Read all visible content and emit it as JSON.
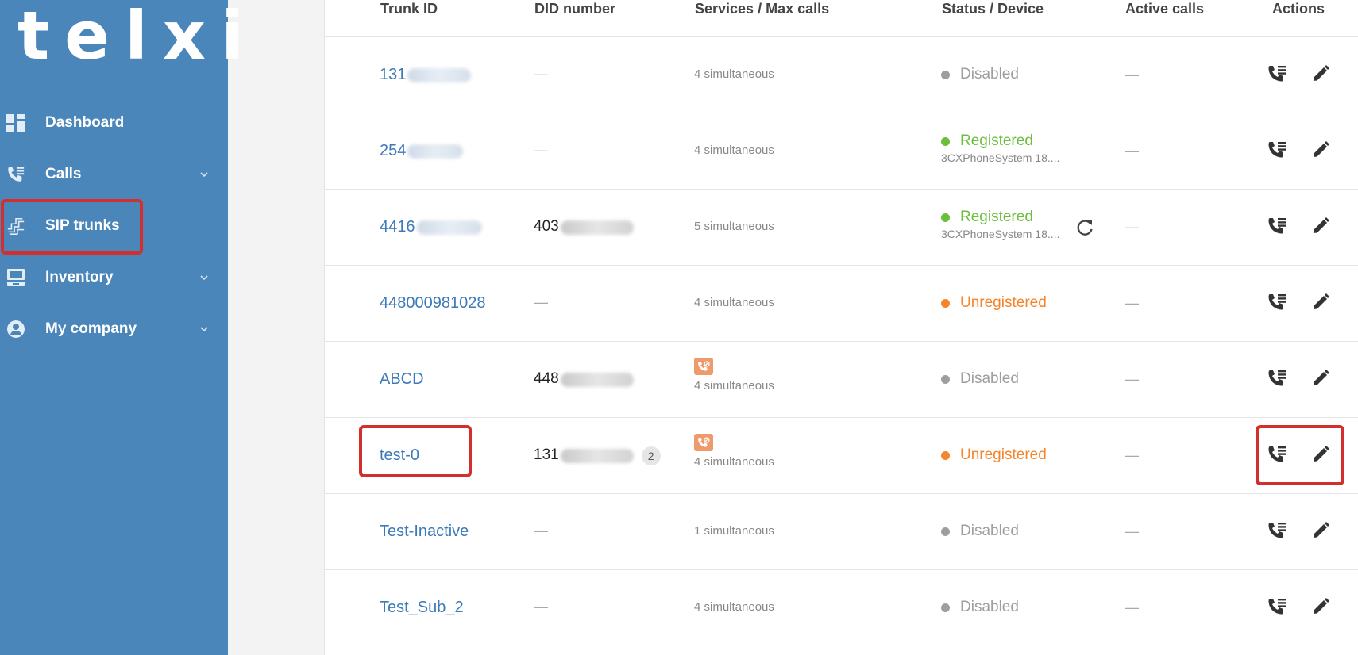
{
  "brand": {
    "logo_text": "telxi"
  },
  "sidebar": {
    "items": [
      {
        "label": "Dashboard",
        "icon": "dashboard-icon",
        "has_chevron": false
      },
      {
        "label": "Calls",
        "icon": "calls-icon",
        "has_chevron": true
      },
      {
        "label": "SIP trunks",
        "icon": "sip-trunks-icon",
        "has_chevron": false,
        "active": true
      },
      {
        "label": "Inventory",
        "icon": "inventory-icon",
        "has_chevron": true
      },
      {
        "label": "My company",
        "icon": "company-icon",
        "has_chevron": true
      }
    ]
  },
  "table": {
    "headers": {
      "trunk_id": "Trunk ID",
      "did_number": "DID number",
      "services": "Services / Max calls",
      "status": "Status / Device",
      "active_calls": "Active calls",
      "actions": "Actions"
    },
    "rows": [
      {
        "trunk_id": "131",
        "trunk_blurred": true,
        "did": "—",
        "did_blurred": false,
        "service_icon": false,
        "services": "4 simultaneous",
        "status": "Disabled",
        "status_color": "#9e9e9e",
        "device": "",
        "refresh": false,
        "active_calls": "—"
      },
      {
        "trunk_id": "254",
        "trunk_blurred": true,
        "did": "—",
        "did_blurred": false,
        "service_icon": false,
        "services": "4 simultaneous",
        "status": "Registered",
        "status_color": "#6cbf3c",
        "device": "3CXPhoneSystem 18....",
        "refresh": false,
        "active_calls": "—"
      },
      {
        "trunk_id": "4416",
        "trunk_blurred": true,
        "did": "403",
        "did_blurred": true,
        "service_icon": false,
        "services": "5 simultaneous",
        "status": "Registered",
        "status_color": "#6cbf3c",
        "device": "3CXPhoneSystem 18....",
        "refresh": true,
        "active_calls": "—"
      },
      {
        "trunk_id": "448000981028",
        "trunk_blurred": false,
        "did": "—",
        "did_blurred": false,
        "service_icon": false,
        "services": "4 simultaneous",
        "status": "Unregistered",
        "status_color": "#f5842a",
        "device": "",
        "refresh": false,
        "active_calls": "—"
      },
      {
        "trunk_id": "ABCD",
        "trunk_blurred": false,
        "did": "448",
        "did_blurred": true,
        "service_icon": true,
        "services": "4 simultaneous",
        "status": "Disabled",
        "status_color": "#9e9e9e",
        "device": "",
        "refresh": false,
        "active_calls": "—"
      },
      {
        "trunk_id": "test-0",
        "trunk_blurred": false,
        "did": "131",
        "did_blurred": true,
        "did_badge": "2",
        "service_icon": true,
        "services": "4 simultaneous",
        "status": "Unregistered",
        "status_color": "#f5842a",
        "device": "",
        "refresh": false,
        "active_calls": "—"
      },
      {
        "trunk_id": "Test-Inactive",
        "trunk_blurred": false,
        "did": "—",
        "did_blurred": false,
        "service_icon": false,
        "services": "1 simultaneous",
        "status": "Disabled",
        "status_color": "#9e9e9e",
        "device": "",
        "refresh": false,
        "active_calls": "—"
      },
      {
        "trunk_id": "Test_Sub_2",
        "trunk_blurred": false,
        "did": "—",
        "did_blurred": false,
        "service_icon": false,
        "services": "4 simultaneous",
        "status": "Disabled",
        "status_color": "#9e9e9e",
        "device": "",
        "refresh": false,
        "active_calls": "—"
      }
    ]
  },
  "icons": {
    "call_log": "call-log-icon",
    "edit": "pencil-icon",
    "refresh": "refresh-icon",
    "service": "call-blocked-icon"
  },
  "colors": {
    "sidebar": "#4a86b9",
    "link": "#3d7ab8",
    "registered": "#6cbf3c",
    "unregistered": "#f5842a",
    "disabled": "#9e9e9e",
    "highlight": "#d32f2f"
  }
}
